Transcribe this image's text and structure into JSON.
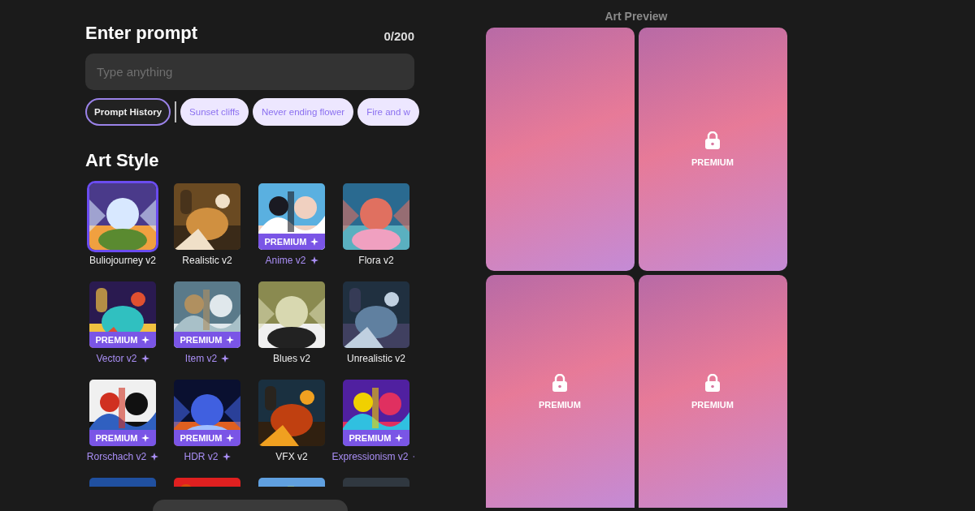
{
  "prompt": {
    "title": "Enter prompt",
    "counter": "0/200",
    "placeholder": "Type anything"
  },
  "chips": [
    {
      "label": "Prompt History",
      "kind": "history",
      "selected": true
    },
    {
      "label": "Sunset cliffs",
      "kind": "suggestion",
      "selected": false
    },
    {
      "label": "Never ending flower",
      "kind": "suggestion",
      "selected": false
    },
    {
      "label": "Fire and w",
      "kind": "suggestion",
      "selected": false
    }
  ],
  "art_style": {
    "title": "Art Style",
    "styles": [
      {
        "label": "Buliojourney v2",
        "selected": true,
        "premium": false
      },
      {
        "label": "Realistic v2",
        "selected": false,
        "premium": false
      },
      {
        "label": "Anime v2",
        "selected": false,
        "premium": true,
        "badge": "PREMIUM"
      },
      {
        "label": "Flora v2",
        "selected": false,
        "premium": false
      },
      {
        "label": "Vector v2",
        "selected": false,
        "premium": true,
        "badge": "PREMIUM"
      },
      {
        "label": "Item v2",
        "selected": false,
        "premium": true,
        "badge": "PREMIUM"
      },
      {
        "label": "Blues v2",
        "selected": false,
        "premium": false
      },
      {
        "label": "Unrealistic v2",
        "selected": false,
        "premium": false
      },
      {
        "label": "Rorschach v2",
        "selected": false,
        "premium": true,
        "badge": "PREMIUM"
      },
      {
        "label": "HDR v2",
        "selected": false,
        "premium": true,
        "badge": "PREMIUM"
      },
      {
        "label": "VFX v2",
        "selected": false,
        "premium": false
      },
      {
        "label": "Expressionism v2",
        "selected": false,
        "premium": true,
        "badge": "PREMIUM"
      },
      {
        "selected": false
      },
      {
        "selected": false
      },
      {
        "selected": false
      },
      {
        "selected": false
      }
    ]
  },
  "preview": {
    "title": "Art Preview",
    "cards": [
      {
        "locked": false
      },
      {
        "locked": true,
        "label": "PREMIUM"
      },
      {
        "locked": true,
        "label": "PREMIUM"
      },
      {
        "locked": true,
        "label": "PREMIUM"
      }
    ]
  }
}
